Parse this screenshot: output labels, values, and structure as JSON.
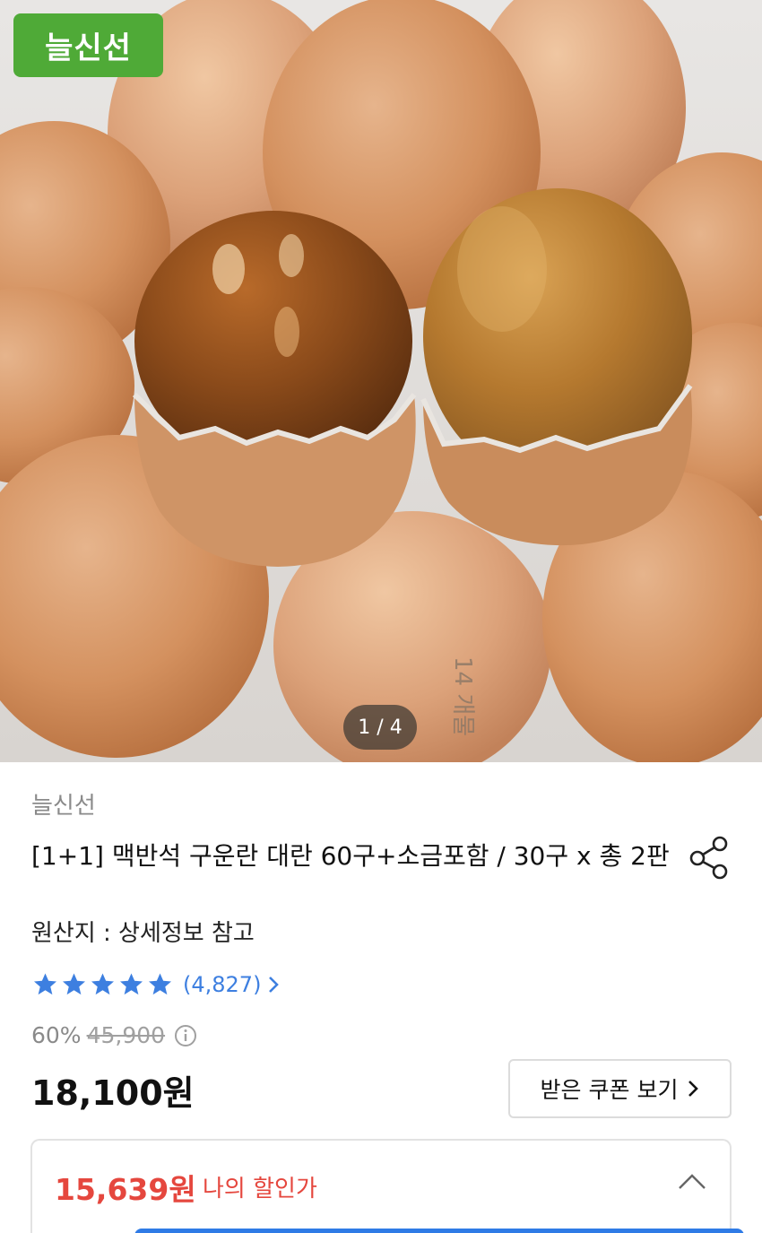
{
  "hero": {
    "image_desc_icon": "eggs-photo",
    "brand_badge": "늘신선",
    "pager": "1 / 4"
  },
  "product": {
    "seller": "늘신선",
    "title": "[1+1] 맥반석 구운란 대란 60구+소금포함 / 30구 x 총 2판",
    "origin": "원산지 : 상세정보 참고",
    "rating": {
      "stars": 5,
      "max_stars": 5,
      "review_count": "(4,827)"
    },
    "discount_rate": "60%",
    "original_price": "45,900",
    "price": "18,100원",
    "coupon_button": "받은 쿠폰 보기",
    "my_price": "15,639원",
    "my_price_label": "나의 할인가"
  },
  "colors": {
    "brand_green": "#4faa37",
    "star_blue": "#3d7fe0",
    "discount_red": "#e5473e"
  }
}
